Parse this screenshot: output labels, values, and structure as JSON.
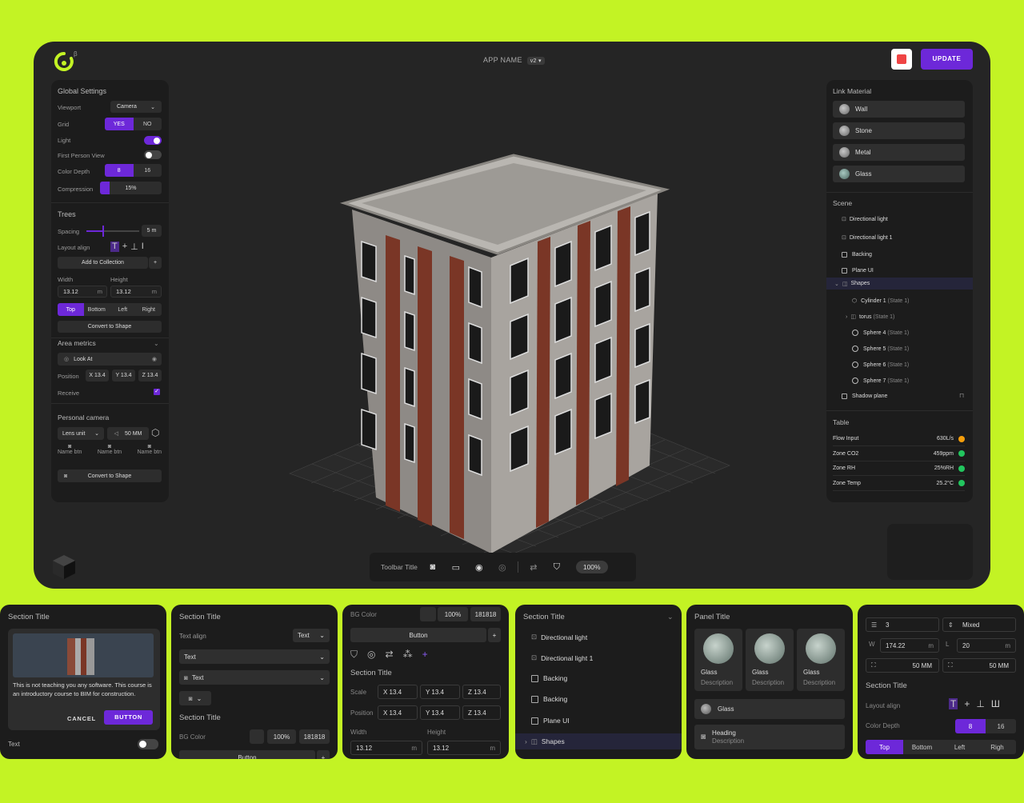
{
  "app": {
    "name": "APP NAME",
    "version": "v2 ▾",
    "update": "UPDATE",
    "beta": "β"
  },
  "global": {
    "title": "Global Settings",
    "viewport_label": "Viewport",
    "viewport_value": "Camera",
    "grid_label": "Grid",
    "grid_yes": "YES",
    "grid_no": "NO",
    "light_label": "Light",
    "light_on": true,
    "fpv_label": "First Person View",
    "fpv_on": false,
    "color_depth_label": "Color Depth",
    "cd_a": "8",
    "cd_b": "16",
    "compression_label": "Compression",
    "compression_value": "15%",
    "compression_level": 0.15
  },
  "trees": {
    "title": "Trees",
    "spacing_label": "Spacing",
    "spacing_value": "5 m",
    "spacing_level": 0.3,
    "layout_label": "Layout align",
    "add_btn": "Add to Collection",
    "width_label": "Width",
    "height_label": "Height",
    "width_value": "13.12",
    "height_value": "13.12",
    "unit": "m",
    "align": [
      "Top",
      "Bottom",
      "Left",
      "Right"
    ],
    "convert": "Convert to Shape"
  },
  "area": {
    "title": "Area metrics",
    "look_at": "Look At",
    "position_label": "Position",
    "x": "X 13.4",
    "y": "Y 13.4",
    "z": "Z 13.4",
    "receive_label": "Receive"
  },
  "camera": {
    "title": "Personal camera",
    "lens": "Lens unit",
    "mm": "50 MM",
    "names": [
      "Name btn",
      "Name btn",
      "Name btn"
    ],
    "convert": "Convert to Shape"
  },
  "materials": {
    "title": "Link Material",
    "items": [
      "Wall",
      "Stone",
      "Metal",
      "Glass"
    ]
  },
  "scene": {
    "title": "Scene",
    "items": [
      {
        "name": "Directional light",
        "state": ""
      },
      {
        "name": "Directional light 1",
        "state": ""
      },
      {
        "name": "Backing",
        "state": ""
      },
      {
        "name": "Plane UI",
        "state": ""
      },
      {
        "name": "Shapes",
        "state": ""
      },
      {
        "name": "Cylinder 1",
        "state": "(State 1)"
      },
      {
        "name": "torus",
        "state": "(State 1)"
      },
      {
        "name": "Sphere 4",
        "state": "(State 1)"
      },
      {
        "name": "Sphere 5",
        "state": "(State 1)"
      },
      {
        "name": "Sphere 6",
        "state": "(State 1)"
      },
      {
        "name": "Sphere 7",
        "state": "(State 1)"
      },
      {
        "name": "Shadow plane",
        "state": ""
      }
    ]
  },
  "table": {
    "title": "Table",
    "rows": [
      {
        "label": "Flow Input",
        "value": "630L/s",
        "status": "#f59e0b"
      },
      {
        "label": "Zone CO2",
        "value": "459ppm",
        "status": "#22c55e"
      },
      {
        "label": "Zone RH",
        "value": "25%RH",
        "status": "#22c55e"
      },
      {
        "label": "Zone Temp",
        "value": "25.2°C",
        "status": "#22c55e"
      }
    ]
  },
  "toolbar": {
    "title": "Toolbar Title",
    "zoom": "100%"
  },
  "colors": {
    "accent": "#6d28d9",
    "bg": "#c3f324"
  },
  "cards": {
    "c1": {
      "title": "Section Title",
      "body": "This is not teaching you any software. This course is an introductory course to BIM for construction.",
      "cancel": "CANCEL",
      "button": "BUTTON",
      "text": "Text"
    },
    "c2": {
      "title": "Section Title",
      "text_align": "Text align",
      "text_value": "Text",
      "dd1": "Text",
      "dd2": "Text",
      "title2": "Section Title",
      "bg_color": "BG Color",
      "pct": "100%",
      "hex": "181818",
      "button": "Button"
    },
    "c3": {
      "bg_color": "BG Color",
      "pct": "100%",
      "hex": "181818",
      "button": "Button",
      "title": "Section Title",
      "scale": "Scale",
      "position": "Position",
      "x": "X 13.4",
      "y": "Y 13.4",
      "z": "Z 13.4",
      "width": "Width",
      "height": "Height",
      "w": "13.12",
      "h": "13.12",
      "unit": "m"
    },
    "c4": {
      "title": "Section Title",
      "items": [
        "Directional light",
        "Directional light 1",
        "Backing",
        "Backing",
        "Plane UI",
        "Shapes"
      ]
    },
    "c5": {
      "title": "Panel Title",
      "tiles": [
        {
          "t": "Glass",
          "d": "Description"
        },
        {
          "t": "Glass",
          "d": "Description"
        },
        {
          "t": "Glass",
          "d": "Description"
        }
      ],
      "glass": "Glass",
      "heading": "Heading",
      "desc": "Description"
    },
    "c6": {
      "rows_val": "3",
      "mixed": "Mixed",
      "w_label": "W",
      "w_val": "174.22",
      "l_label": "L",
      "l_val": "20",
      "mm": "50 MM",
      "title": "Section Title",
      "layout": "Layout align",
      "cd": "Color Depth",
      "cd_a": "8",
      "cd_b": "16",
      "align": [
        "Top",
        "Bottom",
        "Left",
        "Righ"
      ],
      "unit": "m"
    }
  }
}
